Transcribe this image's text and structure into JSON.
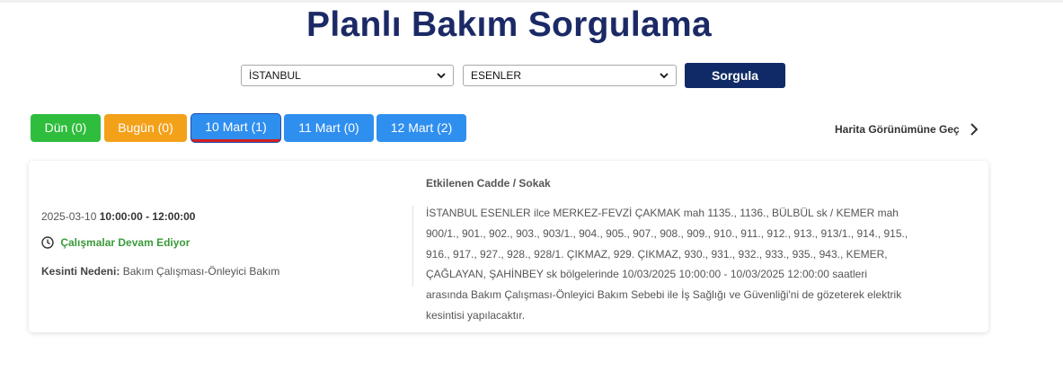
{
  "page_title": "Planlı Bakım Sorgulama",
  "filters": {
    "city": "İSTANBUL",
    "district": "ESENLER",
    "query_button": "Sorgula"
  },
  "tabs": [
    {
      "label": "Dün (0)",
      "color": "#2ebd3c"
    },
    {
      "label": "Bugün (0)",
      "color": "#f4a11a"
    },
    {
      "label": "10 Mart (1)",
      "color": "#2f8fef",
      "active": true
    },
    {
      "label": "11 Mart (0)",
      "color": "#2f8fef"
    },
    {
      "label": "12 Mart (2)",
      "color": "#2f8fef"
    }
  ],
  "map_link": "Harita Görünümüne Geç",
  "outage": {
    "date": "2025-03-10",
    "time_range": "10:00:00 - 12:00:00",
    "status": "Çalışmalar Devam Ediyor",
    "reason_label": "Kesinti Nedeni:",
    "reason_value": "Bakım Çalışması-Önleyici Bakım",
    "affected_heading": "Etkilenen Cadde / Sokak",
    "affected_text": "İSTANBUL ESENLER ilce MERKEZ-FEVZİ ÇAKMAK mah 1135., 1136., BÜLBÜL sk / KEMER mah 900/1., 901., 902., 903., 903/1., 904., 905., 907., 908., 909., 910., 911., 912., 913., 913/1., 914., 915., 916., 917., 927., 928., 928/1. ÇIKMAZ, 929. ÇIKMAZ, 930., 931., 932., 933., 935., 943., KEMER, ÇAĞLAYAN, ŞAHİNBEY sk bölgelerinde 10/03/2025 10:00:00 - 10/03/2025 12:00:00 saatleri arasında Bakım Çalışması-Önleyici Bakım Sebebi ile İş Sağlığı ve Güvenliği'ni de gözeterek elektrik kesintisi yapılacaktır."
  },
  "colors": {
    "title": "#1b2a66",
    "query_button_bg": "#0f2a66",
    "status_green": "#3a9a3a",
    "active_underline": "#d32020"
  },
  "icons": {
    "select_chevron": "chevron-down-icon",
    "map_link_arrow": "chevron-right-icon",
    "status": "clock-icon"
  }
}
